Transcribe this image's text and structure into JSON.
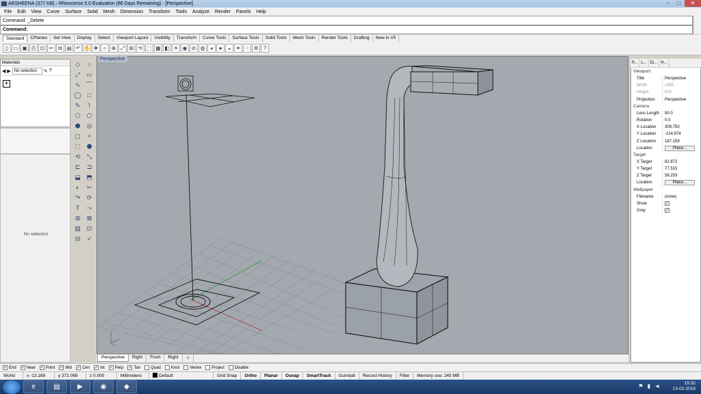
{
  "window": {
    "title": "ARSHEENA (377 KB) - Rhinoceros 5.0 Evaluation (88 Days Remaining) - [Perspective]",
    "min": "–",
    "max": "□",
    "close": "✕"
  },
  "menu": [
    "File",
    "Edit",
    "View",
    "Curve",
    "Surface",
    "Solid",
    "Mesh",
    "Dimension",
    "Transform",
    "Tools",
    "Analyze",
    "Render",
    "Panels",
    "Help"
  ],
  "command": {
    "history": "Command: _Delete",
    "prompt": "Command:"
  },
  "toolbar_tabs": [
    "Standard",
    "CPlanes",
    "Set View",
    "Display",
    "Select",
    "Viewport Layout",
    "Visibility",
    "Transform",
    "Curve Tools",
    "Surface Tools",
    "Solid Tools",
    "Mesh Tools",
    "Render Tools",
    "Drafting",
    "New in V5"
  ],
  "toolbar_icons": [
    "new-icon",
    "open-icon",
    "save-icon",
    "print-icon",
    "import-icon",
    "cut-icon",
    "copy-icon",
    "paste-icon",
    "undo-icon",
    "pan-icon",
    "rotate-icon",
    "zoom-icon",
    "zoom-window-icon",
    "zoom-extents-icon",
    "zoom-selected-icon",
    "undo-view-icon",
    "select-icon",
    "grid-icon",
    "layer-icon",
    "lightbulb-icon",
    "properties-icon",
    "lock-icon",
    "color-icon",
    "material-icon",
    "render-icon",
    "sphere-icon",
    "light-icon",
    "points-icon",
    "options-icon",
    "help-icon"
  ],
  "materials": {
    "header": "Materials",
    "selection": "No selection",
    "nosel": "No selection",
    "add": "+"
  },
  "left_tools": [
    "◇",
    "○",
    "⤢",
    "▭",
    "∿",
    "⌒",
    "◯",
    "□",
    "✎",
    "⌇",
    "⬠",
    "⬡",
    "⬢",
    "◎",
    "▢",
    "✧",
    "⬚",
    "⬣",
    "⟲",
    "⤡",
    "⊏",
    "⊐",
    "⬓",
    "⬒",
    "◐",
    "✂",
    "↷",
    "⟳",
    "T",
    "⤳",
    "⊞",
    "⊠",
    "▤",
    "⊡",
    "⊟",
    "✓",
    "◫",
    "▲"
  ],
  "viewport": {
    "label": "Perspective",
    "tabs": [
      "Perspective",
      "Right",
      "Front",
      "Right",
      "⊹"
    ]
  },
  "properties": {
    "tabs": [
      "P...",
      "L...",
      "Di...",
      "H..."
    ],
    "viewport_section": "Viewport",
    "title_label": "Title",
    "title_value": "Perspective",
    "width_label": "Width",
    "width_value": "1455",
    "height_label": "Height",
    "height_value": "814",
    "projection_label": "Projection",
    "projection_value": "Perspective",
    "camera_section": "Camera",
    "lens_label": "Lens Length",
    "lens_value": "50.0",
    "rotation_label": "Rotation",
    "rotation_value": "0.0",
    "xloc_label": "X Location",
    "xloc_value": "309.750",
    "yloc_label": "Y Location",
    "yloc_value": "-214.974",
    "zloc_label": "Z Location",
    "zloc_value": "187.159",
    "loc_label": "Location",
    "place_label": "Place...",
    "target_section": "Target",
    "xt_label": "X Target",
    "xt_value": "82.872",
    "yt_label": "Y Target",
    "yt_value": "77.515",
    "zt_label": "Z Target",
    "zt_value": "58.253",
    "tloc_label": "Location",
    "tplace_label": "Place...",
    "wallpaper_section": "Wallpaper",
    "file_label": "Filename",
    "file_value": "(none)",
    "show_label": "Show",
    "gray_label": "Gray",
    "check": "✓"
  },
  "osnaps": [
    {
      "label": "End",
      "checked": true
    },
    {
      "label": "Near",
      "checked": true
    },
    {
      "label": "Point",
      "checked": true
    },
    {
      "label": "Mid",
      "checked": true
    },
    {
      "label": "Cen",
      "checked": true
    },
    {
      "label": "Int",
      "checked": true
    },
    {
      "label": "Perp",
      "checked": true
    },
    {
      "label": "Tan",
      "checked": true
    },
    {
      "label": "Quad",
      "checked": false
    },
    {
      "label": "Knot",
      "checked": false
    },
    {
      "label": "Vertex",
      "checked": false
    },
    {
      "label": "Project",
      "checked": false
    },
    {
      "label": "Disable",
      "checked": false
    }
  ],
  "status": {
    "cplane": "World",
    "x": "x -13.169",
    "y": "y 372.069",
    "z": "z 0.000",
    "units": "Millimeters",
    "layer": "Default",
    "grid_snap": "Grid Snap",
    "ortho": "Ortho",
    "planar": "Planar",
    "osnap": "Osnap",
    "smarttrack": "SmartTrack",
    "gumball": "Gumball",
    "record": "Record History",
    "filter": "Filter",
    "memory": "Memory use: 245 MB"
  },
  "taskbar": {
    "time": "15:32",
    "date": "13-02-2016",
    "apps": [
      "ie-icon",
      "explorer-icon",
      "media-icon",
      "chrome-icon",
      "rhino-icon"
    ]
  }
}
